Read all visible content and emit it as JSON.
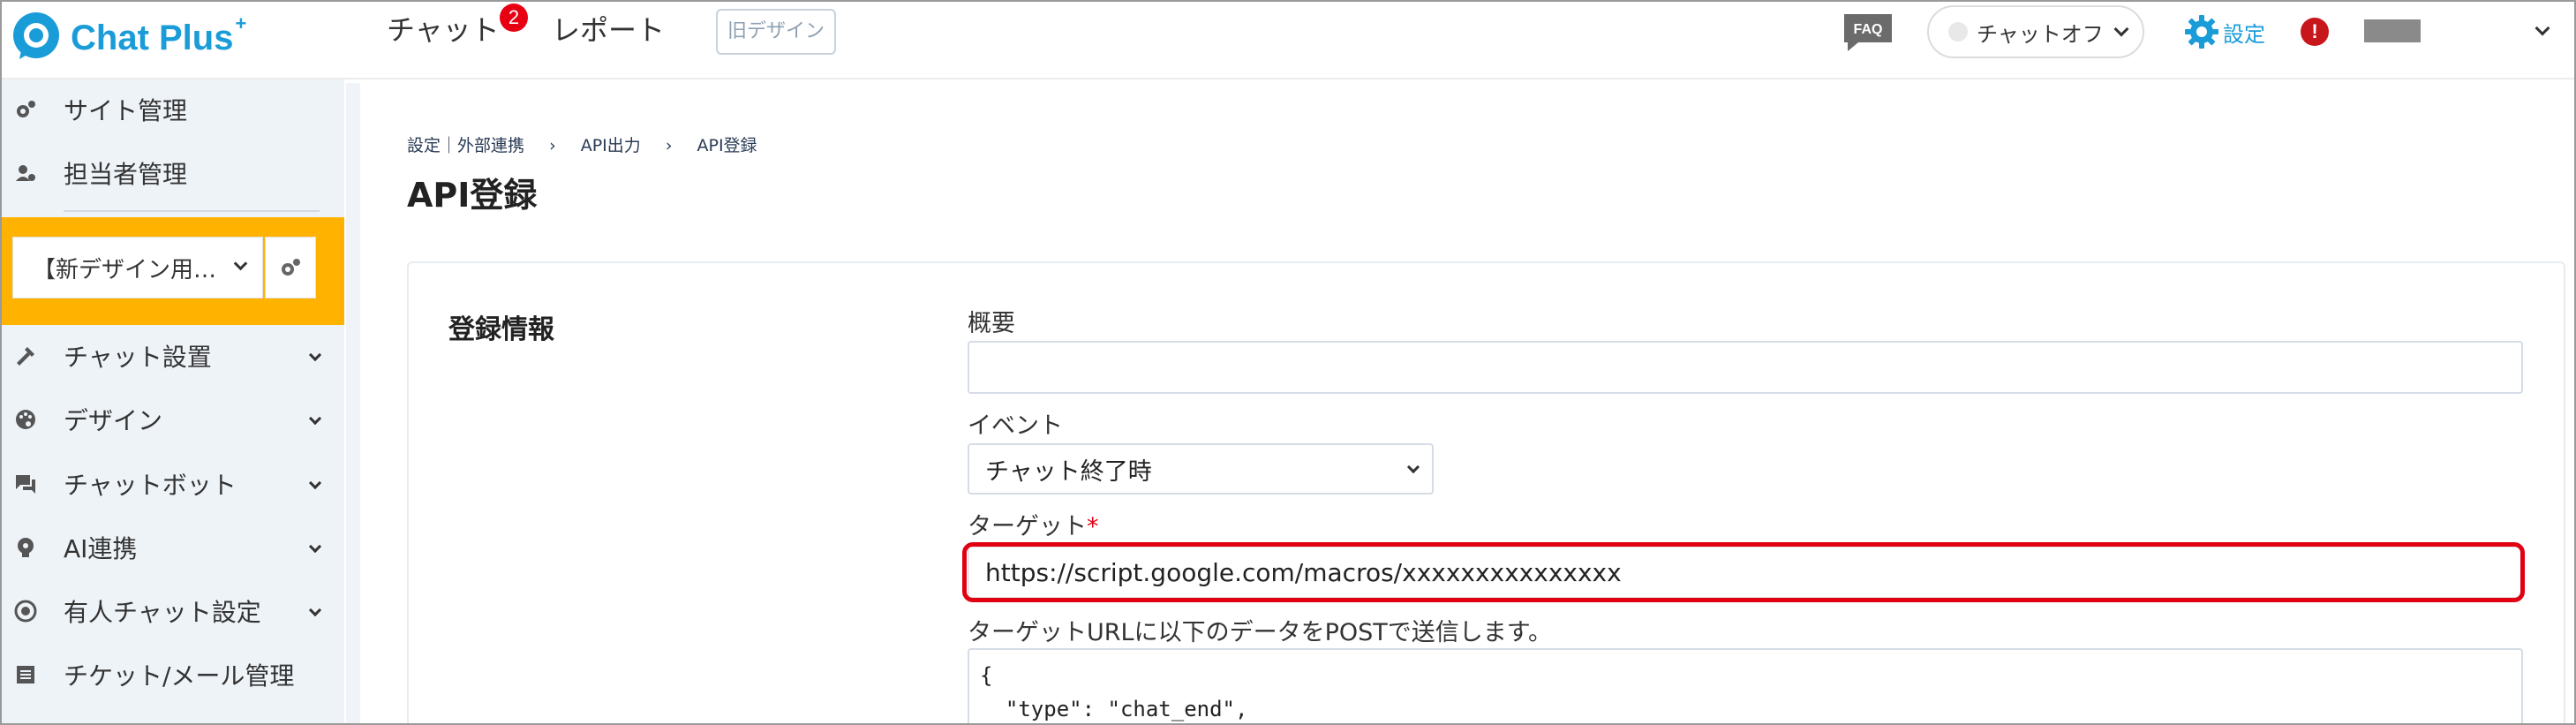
{
  "header": {
    "logo_text": "Chat Plus",
    "logo_sup": "+",
    "nav_chat": "チャット",
    "nav_chat_badge": "2",
    "nav_report": "レポート",
    "old_design_button": "旧デザイン",
    "faq_label": "FAQ",
    "status_select": "チャットオフ",
    "settings_label": "設定",
    "alert_mark": "!"
  },
  "sidebar": {
    "items_top": [
      {
        "label": "サイト管理",
        "icon": "gear-cluster-icon"
      },
      {
        "label": "担当者管理",
        "icon": "users-gear-icon"
      }
    ],
    "site_select": "【新デザイン用…",
    "items": [
      {
        "label": "チャット設置",
        "icon": "tools-icon"
      },
      {
        "label": "デザイン",
        "icon": "palette-icon"
      },
      {
        "label": "チャットボット",
        "icon": "chat-bubbles-icon"
      },
      {
        "label": "AI連携",
        "icon": "ai-bulb-icon"
      },
      {
        "label": "有人チャット設定",
        "icon": "operator-icon"
      },
      {
        "label": "チケット/メール管理",
        "icon": "ticket-list-icon"
      }
    ]
  },
  "main": {
    "breadcrumb": [
      "設定｜外部連携",
      "›",
      "API出力",
      "›",
      "API登録"
    ],
    "page_title": "API登録",
    "card_title": "登録情報",
    "fields": {
      "summary_label": "概要",
      "summary_value": "",
      "event_label": "イベント",
      "event_value": "チャット終了時",
      "target_label": "ターゲット",
      "target_required": "*",
      "target_value": "https://script.google.com/macros/xxxxxxxxxxxxxxx",
      "post_note": "ターゲットURLに以下のデータをPOSTで送信します。",
      "payload_line1": "{",
      "payload_line2": "  \"type\": \"chat_end\","
    }
  },
  "colors": {
    "brand": "#1a9cd8",
    "badge": "#e60012",
    "site_box": "#ffb300",
    "sidebar_bg": "#eef3f8",
    "highlight": "#e00012"
  }
}
